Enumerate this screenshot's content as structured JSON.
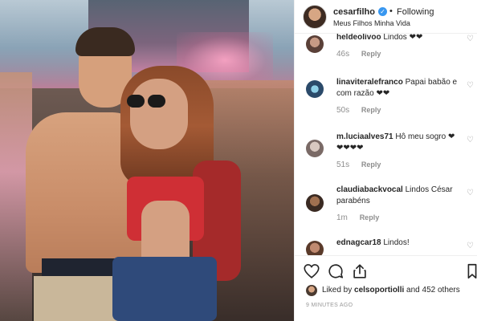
{
  "post": {
    "username": "cesarfilho",
    "following_label": "Following",
    "location": "Meus Filhos Minha Vida"
  },
  "comments": [
    {
      "username": "heldeolivoo",
      "text": "Lindos ❤❤",
      "age": "46s",
      "reply_label": "Reply"
    },
    {
      "username": "linaviteralefranco",
      "text": "Papai babão e com razão ❤❤",
      "age": "50s",
      "reply_label": "Reply"
    },
    {
      "username": "m.luciaalves71",
      "text": "Hô meu sogro ❤ ❤❤❤❤",
      "age": "51s",
      "reply_label": "Reply"
    },
    {
      "username": "claudiabackvocal",
      "text": "Lindos César parabéns",
      "age": "1m",
      "reply_label": "Reply"
    },
    {
      "username": "ednagcar18",
      "text": "Lindos!",
      "age": "",
      "reply_label": ""
    }
  ],
  "likes": {
    "prefix": "Liked by",
    "user": "celsoportiolli",
    "suffix": "and 452 others"
  },
  "timestamp": "9 MINUTES AGO",
  "icons": {
    "verified": "verified-badge-icon",
    "like": "heart-icon",
    "comment": "comment-bubble-icon",
    "share": "share-icon",
    "save": "bookmark-icon",
    "comment_like": "heart-outline-icon"
  },
  "colors": {
    "verified_blue": "#3897f0",
    "meta_gray": "#8e8e8e",
    "text": "#262626",
    "divider": "#efefef"
  }
}
